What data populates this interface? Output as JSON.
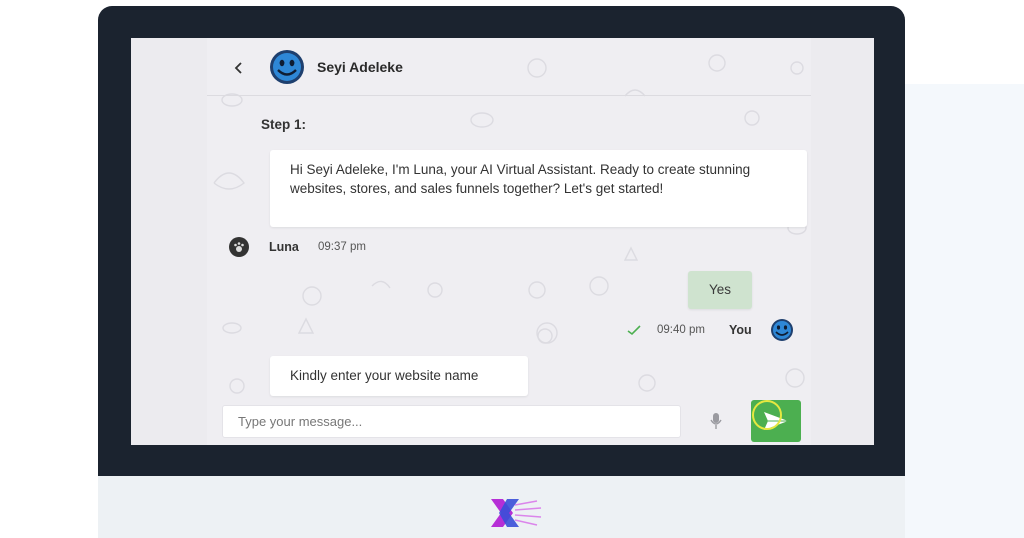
{
  "header": {
    "back_label": "‹",
    "contact_name": "Seyi Adeleke"
  },
  "conversation": {
    "step_label": "Step 1:",
    "messages": [
      {
        "sender": "Luna",
        "text": "Hi Seyi Adeleke, I'm Luna, your AI Virtual Assistant. Ready to create stunning websites, stores, and sales funnels together? Let's get started!",
        "time": "09:37 pm"
      },
      {
        "sender": "You",
        "text": "Yes",
        "time": "09:40 pm"
      },
      {
        "sender": "Luna",
        "text": "Kindly enter your website name"
      }
    ]
  },
  "composer": {
    "placeholder": "Type your message..."
  },
  "colors": {
    "monitor_frame": "#1b232f",
    "chat_background": "#efeef2",
    "user_bubble": "#cfe3cf",
    "send_button": "#4caf50",
    "brand_primary": "#b62fd6",
    "brand_secondary": "#3a4fd8"
  },
  "icons": {
    "back": "chevron-left-icon",
    "avatar": "smiley-avatar-icon",
    "read_receipt": "check-icon",
    "mic": "microphone-icon",
    "send": "paper-plane-icon"
  }
}
